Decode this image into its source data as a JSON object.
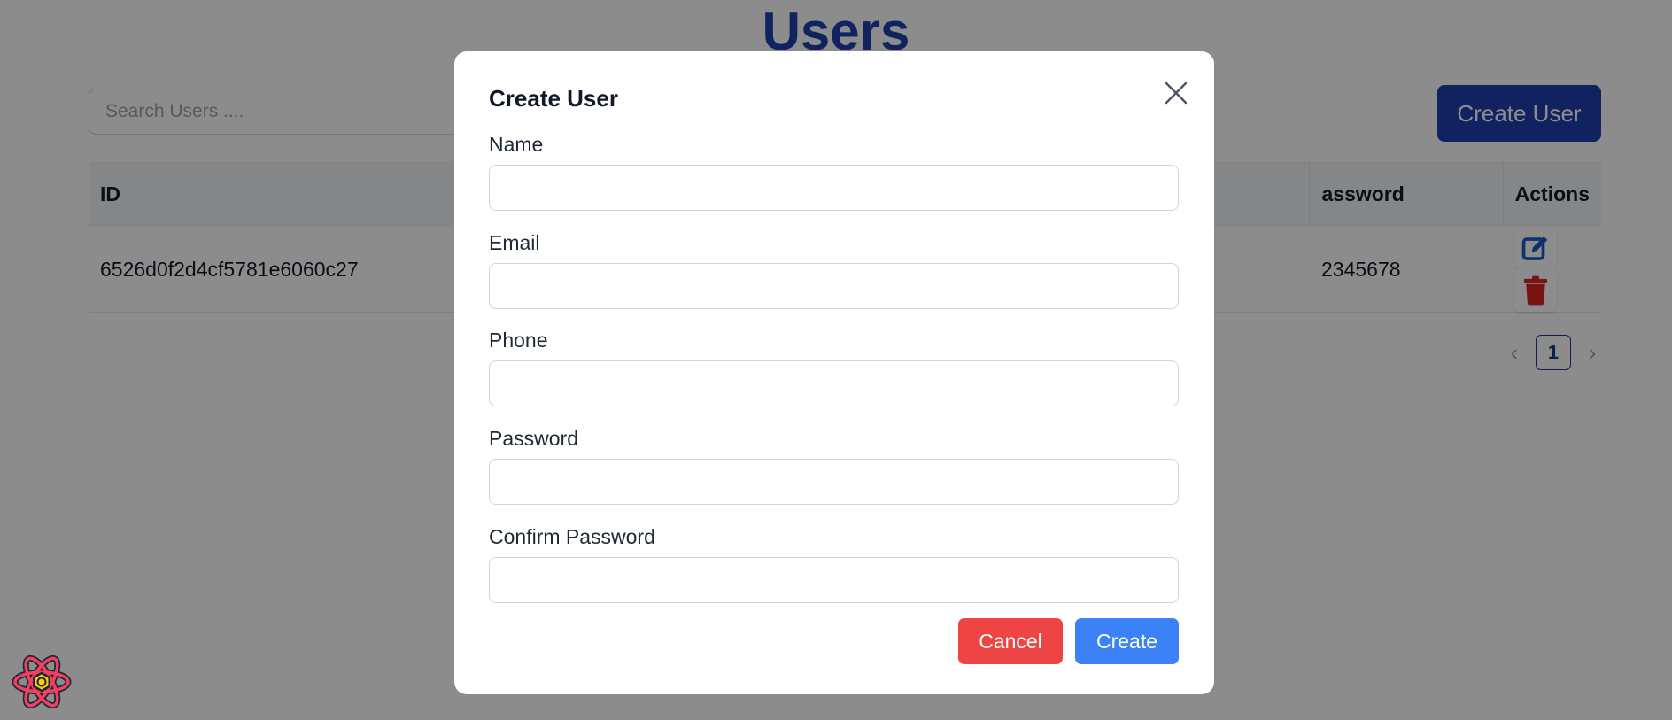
{
  "page": {
    "title": "Users",
    "search": {
      "placeholder": "Search Users ....",
      "value": ""
    },
    "create_button_label": "Create User",
    "table": {
      "columns": [
        "ID",
        "",
        "",
        "",
        "assword",
        "Actions"
      ],
      "rows": [
        {
          "id": "6526d0f2d4cf5781e6060c27",
          "name": "",
          "email": "",
          "phone": "",
          "password": "2345678"
        }
      ]
    },
    "pagination": {
      "current": "1",
      "prev": "‹",
      "next": "›"
    }
  },
  "modal": {
    "title": "Create User",
    "fields": [
      {
        "label": "Name",
        "value": ""
      },
      {
        "label": "Email",
        "value": ""
      },
      {
        "label": "Phone",
        "value": ""
      },
      {
        "label": "Password",
        "value": ""
      },
      {
        "label": "Confirm Password",
        "value": ""
      }
    ],
    "cancel_label": "Cancel",
    "create_label": "Create"
  },
  "colors": {
    "primary": "#1e40af",
    "create": "#3b82f6",
    "cancel": "#ef4444",
    "edit_icon": "#1e58c8",
    "delete_icon": "#dc2626"
  },
  "icons": {
    "close": "close-icon",
    "edit": "edit-icon",
    "delete": "trash-icon",
    "logo": "react-logo-icon"
  }
}
